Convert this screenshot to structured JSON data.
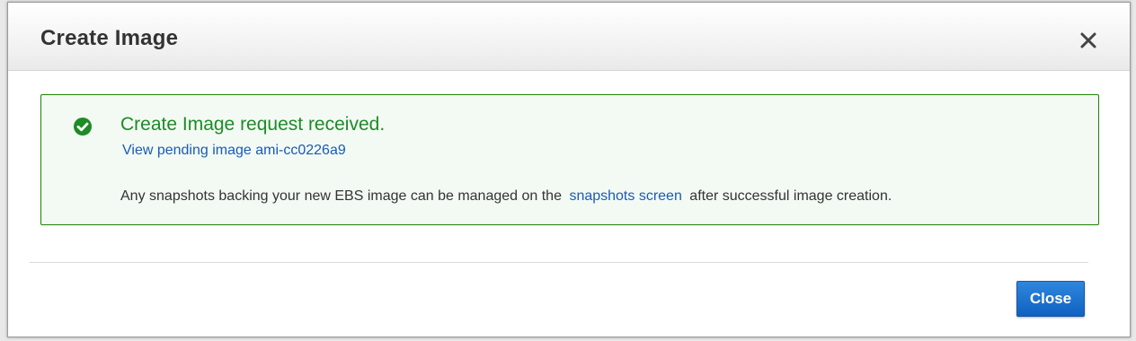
{
  "modal": {
    "title": "Create Image"
  },
  "alert": {
    "title": "Create Image request received.",
    "link_text": "View pending image ami-cc0226a9",
    "body_before": "Any snapshots backing your new EBS image can be managed on the",
    "body_link": "snapshots screen",
    "body_after": "after successful image creation.",
    "icon": "check-circle-icon",
    "status_color": "#1d8102"
  },
  "footer": {
    "close_label": "Close"
  },
  "colors": {
    "accent": "#0f62c0",
    "link": "#1a5ab8",
    "success": "#1d8b26"
  }
}
